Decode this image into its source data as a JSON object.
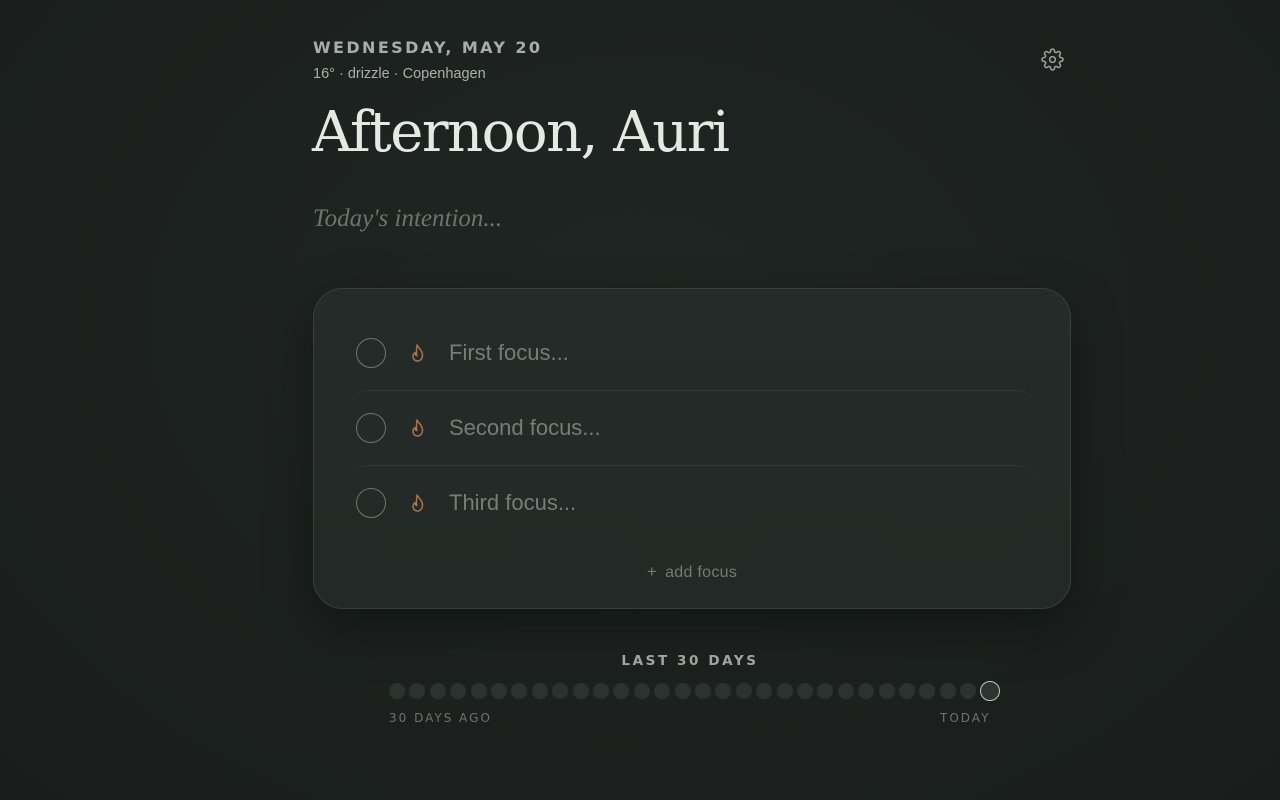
{
  "header": {
    "date": "WEDNESDAY, MAY 20",
    "weather": "16° · drizzle · Copenhagen",
    "greeting": "Afternoon, Auri"
  },
  "intention": {
    "placeholder": "Today's intention..."
  },
  "focus": {
    "items": [
      {
        "placeholder": "First focus..."
      },
      {
        "placeholder": "Second focus..."
      },
      {
        "placeholder": "Third focus..."
      }
    ],
    "add_label": "add focus"
  },
  "streak": {
    "title": "LAST 30 DAYS",
    "start_label": "30 DAYS AGO",
    "end_label": "TODAY",
    "days": 30,
    "completed_days": 0
  },
  "colors": {
    "background": "#1c2220",
    "card": "#232a27",
    "flame": "#a8754a",
    "today_ring": "#b8cbb9"
  },
  "icons": {
    "settings": "gear-icon",
    "flame": "flame-icon",
    "add": "plus-icon"
  }
}
